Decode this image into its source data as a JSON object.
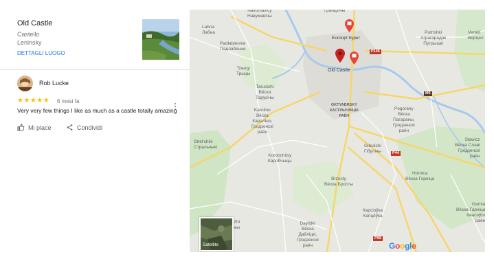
{
  "place": {
    "title": "Old Castle",
    "subtitle1": "Castello",
    "subtitle2": "Leninsky",
    "link": "DETTAGLI LUOGO"
  },
  "review": {
    "author": "Rob Lucke",
    "stars": "★★★★★",
    "rating": 5,
    "time_ago": "6 mesi fa",
    "text": "Very very few things I like as much as a castle totally amazing"
  },
  "actions": {
    "like": "Mi piace",
    "share": "Condividi"
  },
  "map": {
    "labels": [
      "Navumavicy\nНавумавічы",
      "Грандзічы",
      "Labna\nЛабна",
      "Putrishki\nАграгарадок\nПутрышкі",
      "Verteli\nВерцял",
      "Padlabiennie\nПадлабенне",
      "Euroopt hyper",
      "Old Castle",
      "Трыцу\nТрыцы",
      "Tarusichi\nВёска\nТарусічы",
      "OKTYABRSKY\nКАСТРЫЧНІЦКІ\nРАЁН",
      "Karolino\nВёска\nКараліно,\nГродзенскі\nраён",
      "Pogorany\nВёска\nПагараны,\nГродзенскі\nраён",
      "Strel'chiki\nСтральчыкі",
      "Slawicz\nВёска Славі\nГродзенскі\nраён",
      "Korobchitsy\nКаробчыцы",
      "Gibulichi\nГібулічы",
      "Hornica\nВёска Горніца",
      "Brzosty\nВёска Брoсты",
      "Garnia\nВёска Гарніца\nКвасоўск\nраён",
      "Карсіоўка\nКапцёўка",
      "Daylidki\nВёска\nДайлідкі,\nГродзенскі\nраён",
      "Zhi\nжы"
    ],
    "roads": [
      "P145",
      "M6",
      "P44",
      "P99"
    ],
    "satellite_label": "Satellite",
    "logo": "Google"
  },
  "colors": {
    "link": "#1a73e8",
    "star": "#fbbc04",
    "pin": "#ea4335",
    "pin_selected": "#c5221f"
  }
}
